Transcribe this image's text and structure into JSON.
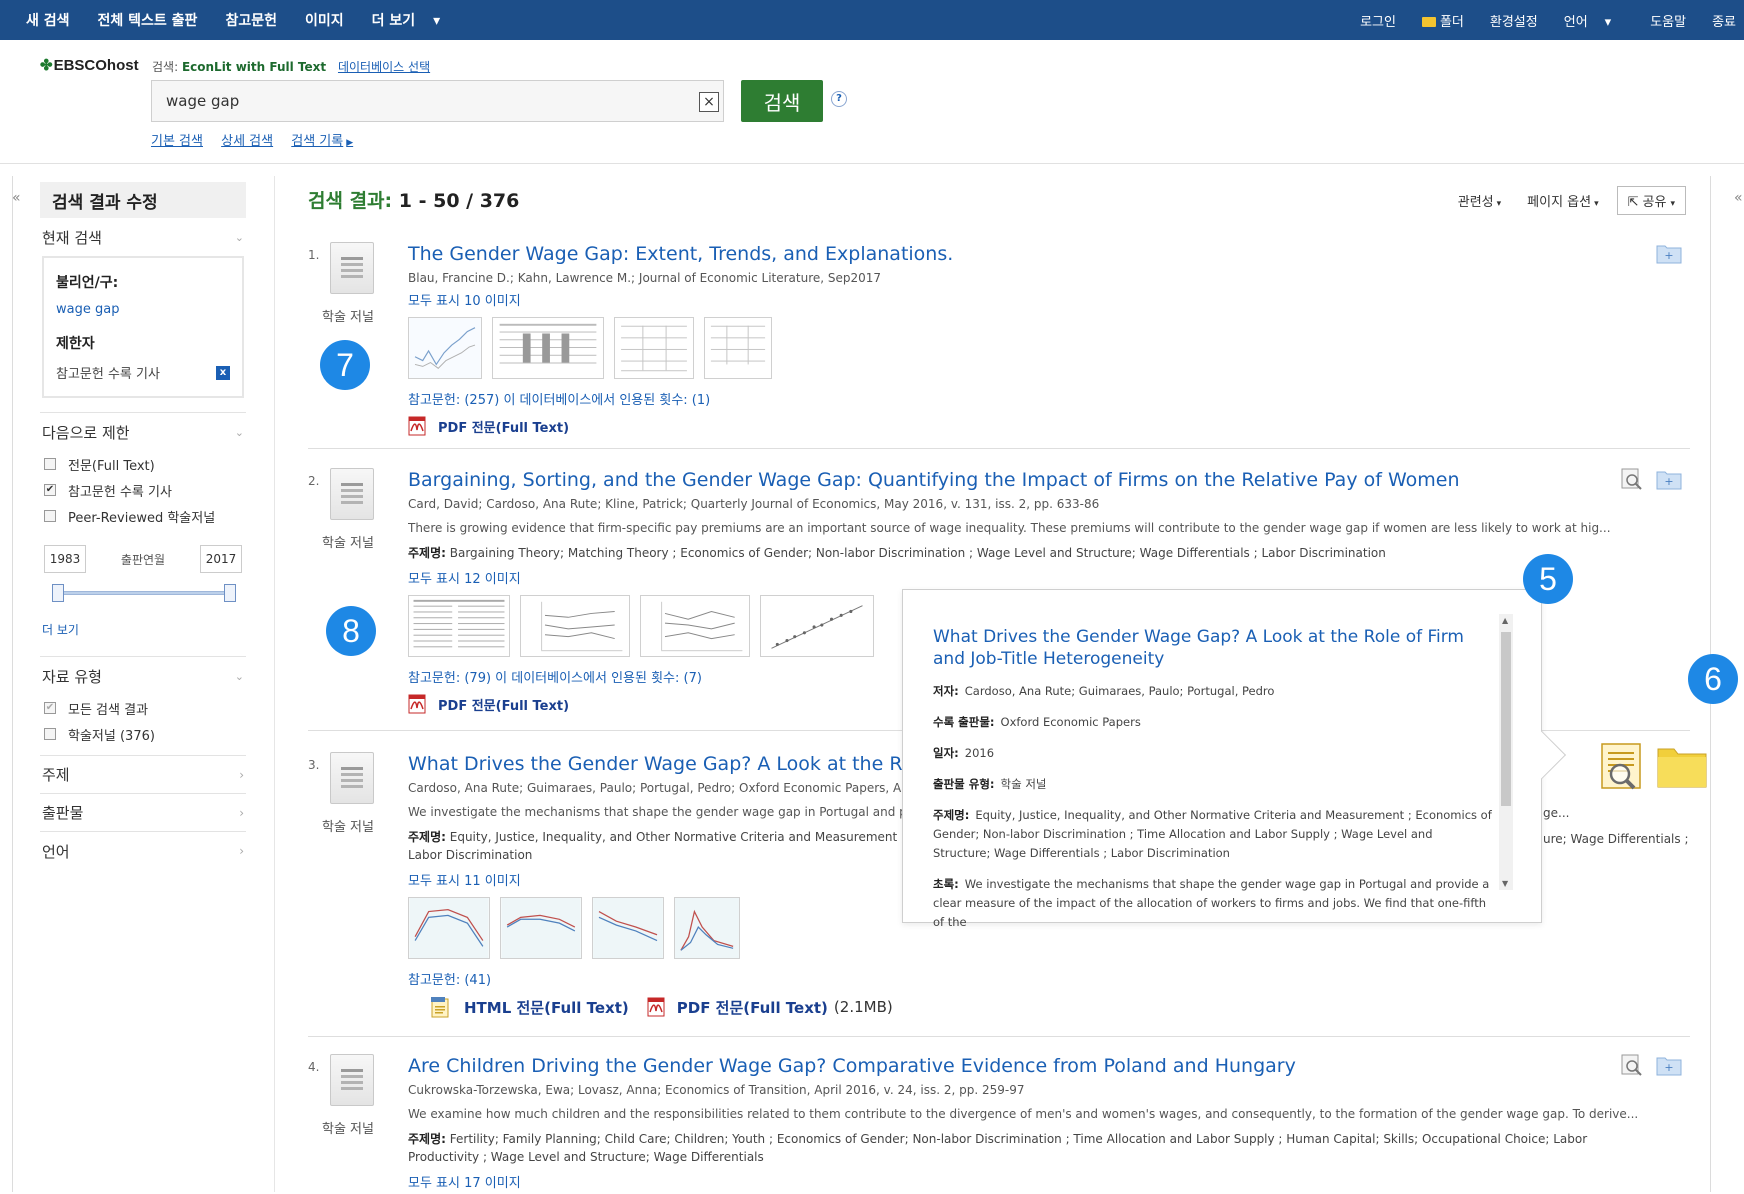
{
  "topnav": {
    "left": [
      "새 검색",
      "전체 텍스트 출판",
      "참고문헌",
      "이미지",
      "더 보기"
    ],
    "right": [
      "로그인",
      "폴더",
      "환경설정",
      "언어",
      "도움말",
      "종료"
    ]
  },
  "header": {
    "logo": "EBSCOhost",
    "db_prefix": "검색:",
    "db_name": "EconLit with Full Text",
    "db_select": "데이터베이스 선택",
    "query": "wage gap",
    "search_button": "검색",
    "help": "?",
    "links": [
      "기본 검색",
      "상세 검색",
      "검색 기록"
    ]
  },
  "sidebar": {
    "title": "검색 결과 수정",
    "current_search": {
      "title": "현재 검색",
      "boolean_label": "불리언/구:",
      "boolean_value": "wage gap",
      "limiter_label": "제한자",
      "limiter_value": "참고문헌 수록 기사",
      "remove_icon": "x"
    },
    "limit_to": {
      "title": "다음으로 제한",
      "options": [
        {
          "label": "전문(Full Text)",
          "checked": false
        },
        {
          "label": "참고문헌 수록 기사",
          "checked": true
        },
        {
          "label": "Peer-Reviewed 학술저널",
          "checked": false
        }
      ],
      "date_from": "1983",
      "date_label": "출판연월",
      "date_to": "2017",
      "more": "더 보기"
    },
    "source_type": {
      "title": "자료 유형",
      "options": [
        {
          "label": "모든 검색 결과",
          "checked": true
        },
        {
          "label": "학술저널 (376)",
          "checked": false
        }
      ]
    },
    "facets": [
      "주제",
      "출판물",
      "언어"
    ]
  },
  "results_header": {
    "label": "검색 결과:",
    "range": "1 - 50 / 376",
    "sort": "관련성",
    "page_options": "페이지 옵션",
    "share": "공유"
  },
  "results": [
    {
      "index": "1.",
      "type": "학술 저널",
      "title": "The Gender Wage Gap: Extent, Trends, and Explanations.",
      "meta": "Blau, Francine D.; Kahn, Lawrence M.; Journal of Economic Literature, Sep2017",
      "images_link": "모두 표시 10 이미지",
      "refs": "참고문헌: (257) 이 데이터베이스에서 인용된 횟수: (1)",
      "pdf": "PDF 전문(Full Text)"
    },
    {
      "index": "2.",
      "type": "학술 저널",
      "title": "Bargaining, Sorting, and the Gender Wage Gap: Quantifying the Impact of Firms on the Relative Pay of Women",
      "meta": "Card, David; Cardoso, Ana Rute; Kline, Patrick; Quarterly Journal of Economics, May 2016, v. 131, iss. 2, pp. 633-86",
      "abstract": "There is growing evidence that firm-specific pay premiums are an important source of wage inequality. These premiums will contribute to the gender wage gap if women are less likely to work at hig...",
      "subjects_label": "주제명:",
      "subjects": "Bargaining Theory; Matching Theory ; Economics of Gender; Non-labor Discrimination ; Wage Level and Structure; Wage Differentials ; Labor Discrimination",
      "images_link": "모두 표시 12 이미지",
      "refs": "참고문헌: (79) 이 데이터베이스에서 인용된 횟수: (7)",
      "pdf": "PDF 전문(Full Text)"
    },
    {
      "index": "3.",
      "type": "학술 저널",
      "title": "What Drives the Gender Wage Gap? A Look at the Role",
      "meta": "Cardoso, Ana Rute; Guimaraes, Paulo; Portugal, Pedro; Oxford Economic Papers, A",
      "abstract": "We investigate the mechanisms that shape the gender wage gap in Portugal and pr",
      "abstract_tail": "ge...",
      "subjects_label": "주제명:",
      "subjects": "Equity, Justice, Inequality, and Other Normative Criteria and Measurement ;",
      "subjects_tail": "ure; Wage Differentials ;",
      "subjects_line2": "Labor Discrimination",
      "images_link": "모두 표시 11 이미지",
      "refs": "참고문헌: (41)",
      "html": "HTML 전문(Full Text)",
      "pdf": "PDF 전문(Full Text)",
      "pdf_size": "(2.1MB)"
    },
    {
      "index": "4.",
      "type": "학술 저널",
      "title": "Are Children Driving the Gender Wage Gap? Comparative Evidence from Poland and Hungary",
      "meta": "Cukrowska-Torzewska, Ewa; Lovasz, Anna; Economics of Transition, April 2016, v. 24, iss. 2, pp. 259-97",
      "abstract": "We examine how much children and the responsibilities related to them contribute to the divergence of men's and women's wages, and consequently, to the formation of the gender wage gap. To derive...",
      "subjects_label": "주제명:",
      "subjects": "Fertility; Family Planning; Child Care; Children; Youth ; Economics of Gender; Non-labor Discrimination ; Time Allocation and Labor Supply ; Human Capital; Skills; Occupational Choice; Labor Productivity ; Wage Level and Structure; Wage Differentials",
      "images_link": "모두 표시 17 이미지"
    }
  ],
  "popup": {
    "title": "What Drives the Gender Wage Gap? A Look at the Role of Firm and Job-Title Heterogeneity",
    "author_label": "저자:",
    "author": "Cardoso, Ana Rute; Guimaraes, Paulo; Portugal, Pedro",
    "source_label": "수록 출판물:",
    "source": "Oxford Economic Papers",
    "date_label": "일자:",
    "date": "2016",
    "pubtype_label": "출판물 유형:",
    "pubtype": "학술 저널",
    "subjects_label": "주제명:",
    "subjects": "Equity, Justice, Inequality, and Other Normative Criteria and Measurement ; Economics of Gender; Non-labor Discrimination ; Time Allocation and Labor Supply ; Wage Level and Structure; Wage Differentials ; Labor Discrimination",
    "abstract_label": "초록:",
    "abstract": "We investigate the mechanisms that shape the gender wage gap in Portugal and provide a clear measure of the impact of the allocation of workers to firms and jobs. We find that one-fifth of the"
  },
  "badges": [
    "7",
    "8",
    "5",
    "6"
  ],
  "colors": {
    "nav": "#1d4e89",
    "accent": "#2e7d32",
    "link": "#1a5fb4",
    "badge": "#1e88e5"
  }
}
